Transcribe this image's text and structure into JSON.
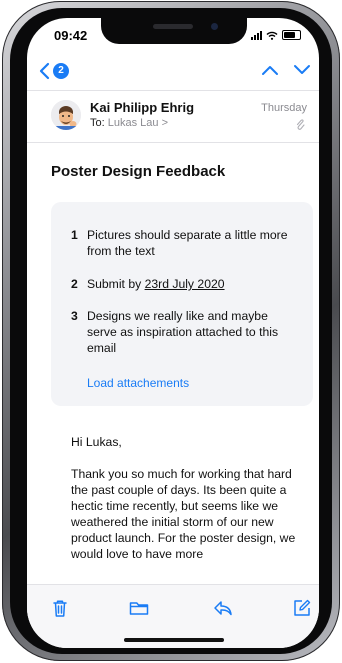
{
  "status_bar": {
    "time": "09:42"
  },
  "nav": {
    "unread_count": "2"
  },
  "message": {
    "sender_name": "Kai Philipp Ehrig",
    "to_label": "To:",
    "recipient": "Lukas Lau >",
    "date": "Thursday",
    "subject": "Poster Design Feedback"
  },
  "summary": {
    "items": [
      {
        "num": "1",
        "text": "Pictures should separate a little more from the text"
      },
      {
        "num": "2",
        "text_prefix": "Submit by ",
        "text_link": "23rd July 2020"
      },
      {
        "num": "3",
        "text": "Designs we really like and maybe serve as inspiration attached to this email"
      }
    ],
    "load_link": "Load attachements"
  },
  "body": {
    "greeting": "Hi Lukas,",
    "paragraph": "Thank you so much for working that hard the past couple of days. Its been quite a hectic time recently, but seems like we weathered the initial storm of our new product launch. For the poster design, we would love to have more"
  },
  "icons": {
    "back": "chevron-left-icon",
    "up": "chevron-up-icon",
    "down": "chevron-down-icon",
    "attachment": "paperclip-icon",
    "trash": "trash-icon",
    "folder": "folder-icon",
    "reply": "reply-icon",
    "compose": "compose-icon"
  },
  "colors": {
    "accent": "#1a7cf5",
    "card_background": "#f3f4f7",
    "muted_text": "#8b8b91"
  }
}
